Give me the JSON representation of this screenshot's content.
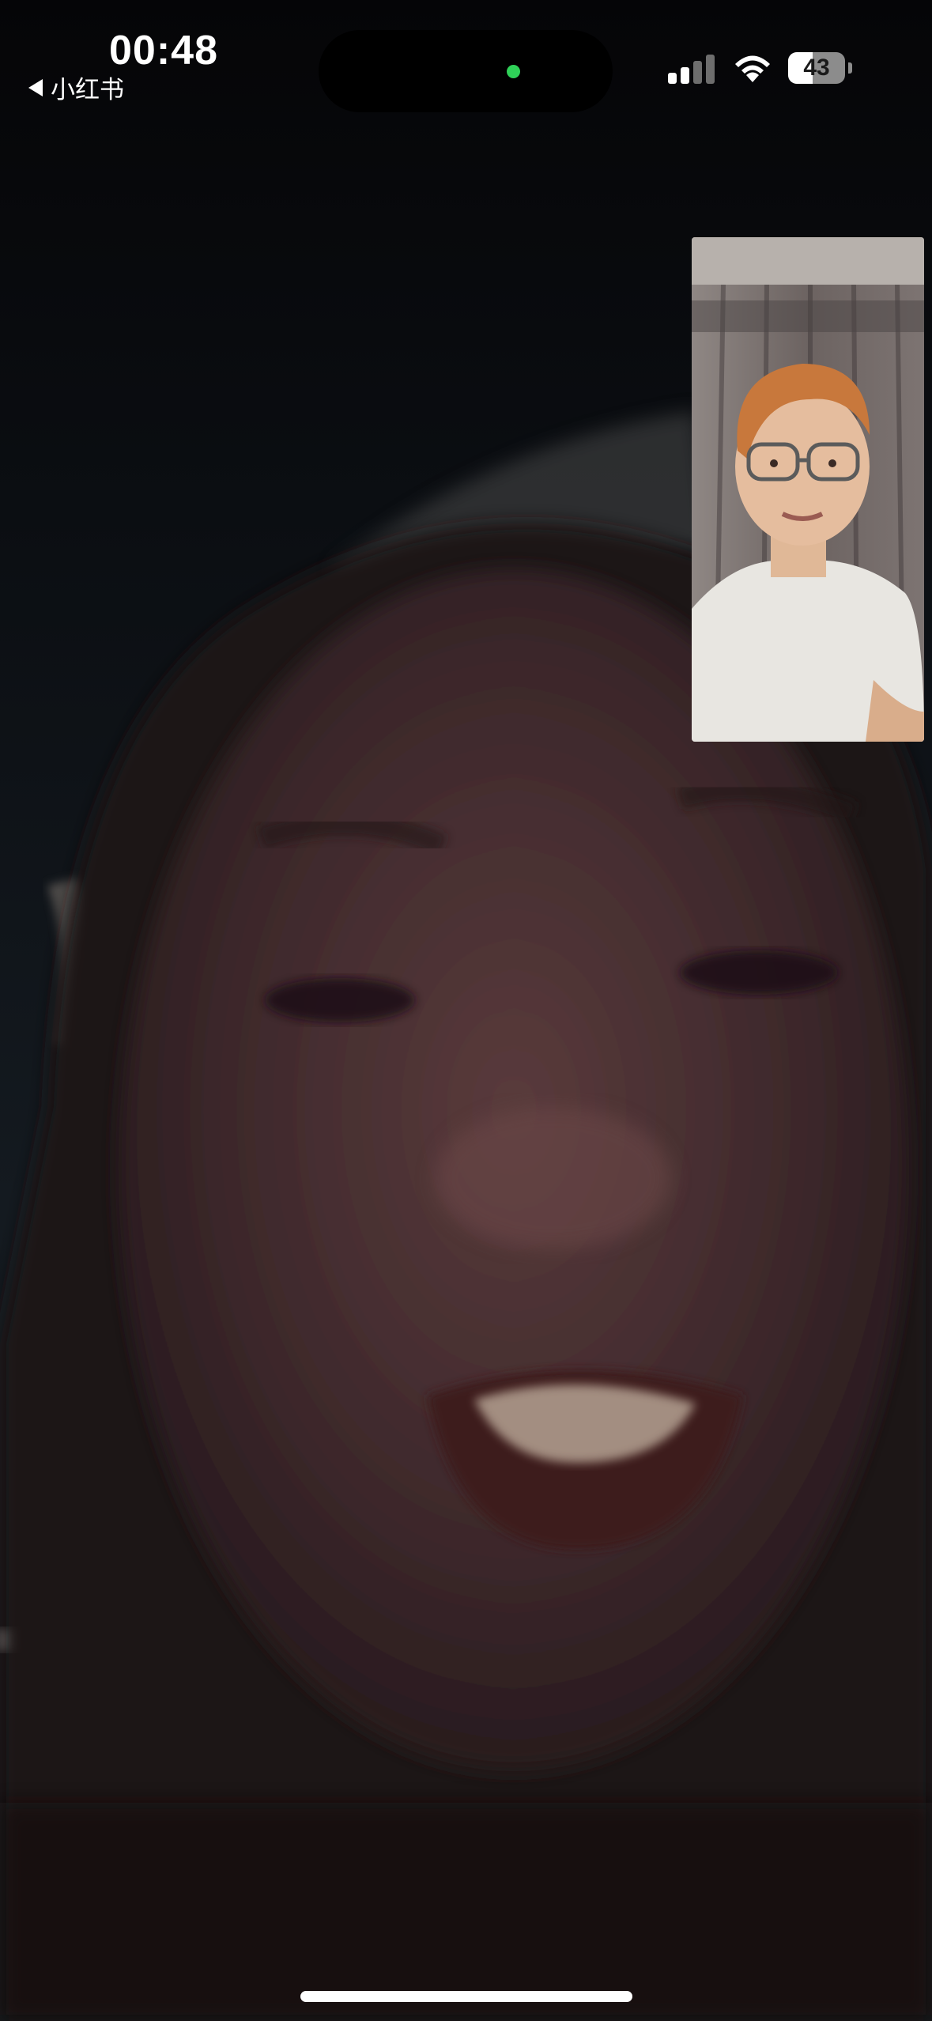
{
  "status_bar": {
    "time": "00:48",
    "back_app_label": "小红书",
    "signal_bars_active": 2,
    "signal_bars_total": 4,
    "battery_level_percent": 43,
    "battery_label": "43",
    "camera_indicator_color": "#2fd158"
  },
  "call": {
    "remote_video": "remote-participant-video",
    "self_view": "self-camera-preview"
  },
  "icons": {
    "back": "back-arrow-icon",
    "signal": "cellular-signal-icon",
    "wifi": "wifi-icon",
    "battery": "battery-icon"
  }
}
